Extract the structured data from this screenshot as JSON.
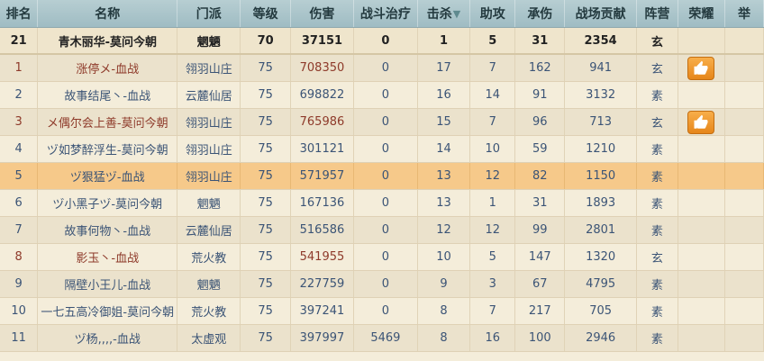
{
  "headers": [
    "排名",
    "名称",
    "门派",
    "等级",
    "伤害",
    "战斗治疗",
    "击杀",
    "助攻",
    "承伤",
    "战场贡献",
    "阵营",
    "荣耀",
    "举"
  ],
  "rows": [
    {
      "rank": "21",
      "name": "青木丽华-莫问今朝",
      "sect": "魍魉",
      "level": "70",
      "damage": "37151",
      "heal": "0",
      "kills": "1",
      "assists": "5",
      "taken": "31",
      "contribution": "2354",
      "camp": "玄",
      "like": false,
      "style": "top",
      "color": "dark"
    },
    {
      "rank": "1",
      "name": "涨停メ-血战",
      "sect": "翎羽山庄",
      "level": "75",
      "damage": "708350",
      "heal": "0",
      "kills": "17",
      "assists": "7",
      "taken": "162",
      "contribution": "941",
      "camp": "玄",
      "like": true,
      "style": "alt",
      "color": "red"
    },
    {
      "rank": "2",
      "name": "故事结尾丶-血战",
      "sect": "云麓仙居",
      "level": "75",
      "damage": "698822",
      "heal": "0",
      "kills": "16",
      "assists": "14",
      "taken": "91",
      "contribution": "3132",
      "camp": "素",
      "like": false,
      "style": "",
      "color": "blue"
    },
    {
      "rank": "3",
      "name": "メ偶尔会上善-莫问今朝",
      "sect": "翎羽山庄",
      "level": "75",
      "damage": "765986",
      "heal": "0",
      "kills": "15",
      "assists": "7",
      "taken": "96",
      "contribution": "713",
      "camp": "玄",
      "like": true,
      "style": "alt",
      "color": "red"
    },
    {
      "rank": "4",
      "name": "ヅ如梦醉浮生-莫问今朝",
      "sect": "翎羽山庄",
      "level": "75",
      "damage": "301121",
      "heal": "0",
      "kills": "14",
      "assists": "10",
      "taken": "59",
      "contribution": "1210",
      "camp": "素",
      "like": false,
      "style": "",
      "color": "blue"
    },
    {
      "rank": "5",
      "name": "ヅ狠猛ヅ-血战",
      "sect": "翎羽山庄",
      "level": "75",
      "damage": "571957",
      "heal": "0",
      "kills": "13",
      "assists": "12",
      "taken": "82",
      "contribution": "1150",
      "camp": "素",
      "like": false,
      "style": "hl",
      "color": "blue"
    },
    {
      "rank": "6",
      "name": "ヅ小黑子ヅ-莫问今朝",
      "sect": "魍魉",
      "level": "75",
      "damage": "167136",
      "heal": "0",
      "kills": "13",
      "assists": "1",
      "taken": "31",
      "contribution": "1893",
      "camp": "素",
      "like": false,
      "style": "",
      "color": "blue"
    },
    {
      "rank": "7",
      "name": "故事何物丶-血战",
      "sect": "云麓仙居",
      "level": "75",
      "damage": "516586",
      "heal": "0",
      "kills": "12",
      "assists": "12",
      "taken": "99",
      "contribution": "2801",
      "camp": "素",
      "like": false,
      "style": "alt",
      "color": "blue"
    },
    {
      "rank": "8",
      "name": "影玉丶-血战",
      "sect": "荒火教",
      "level": "75",
      "damage": "541955",
      "heal": "0",
      "kills": "10",
      "assists": "5",
      "taken": "147",
      "contribution": "1320",
      "camp": "玄",
      "like": false,
      "style": "",
      "color": "red"
    },
    {
      "rank": "9",
      "name": "隔壁小王儿-血战",
      "sect": "魍魉",
      "level": "75",
      "damage": "227759",
      "heal": "0",
      "kills": "9",
      "assists": "3",
      "taken": "67",
      "contribution": "4795",
      "camp": "素",
      "like": false,
      "style": "alt",
      "color": "blue"
    },
    {
      "rank": "10",
      "name": "一七五高冷御姐-莫问今朝",
      "sect": "荒火教",
      "level": "75",
      "damage": "397241",
      "heal": "0",
      "kills": "8",
      "assists": "7",
      "taken": "217",
      "contribution": "705",
      "camp": "素",
      "like": false,
      "style": "",
      "color": "blue"
    },
    {
      "rank": "11",
      "name": "ヅ杨,,,,-血战",
      "sect": "太虚观",
      "level": "75",
      "damage": "397997",
      "heal": "5469",
      "kills": "8",
      "assists": "16",
      "taken": "100",
      "contribution": "2946",
      "camp": "素",
      "like": false,
      "style": "alt",
      "color": "blue"
    }
  ],
  "icons": {
    "sort": "chevron-down-icon",
    "like": "thumbs-up-icon"
  },
  "colors": {
    "header": "#a8c4ca",
    "highlight": "#f6c98a",
    "like": "#ee9a2e",
    "red_text": "#8e3a2a",
    "blue_text": "#3b5476"
  }
}
